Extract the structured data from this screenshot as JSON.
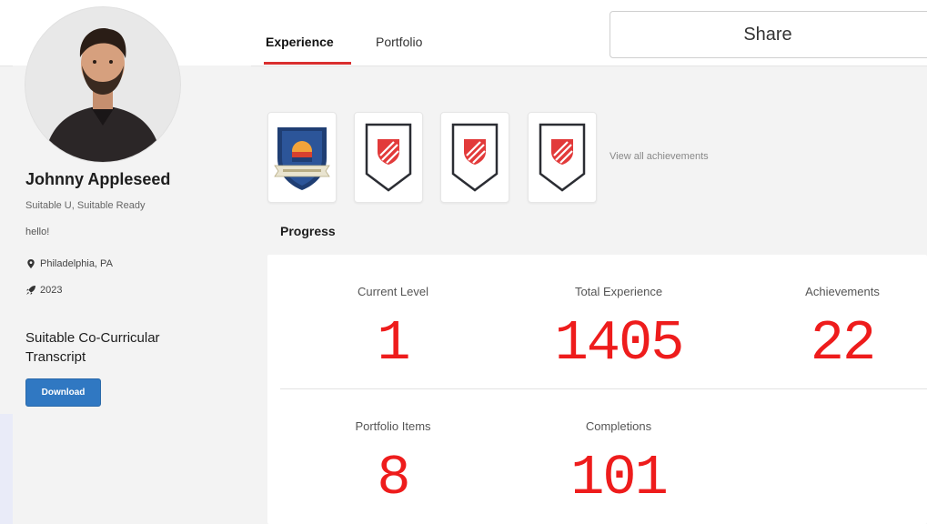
{
  "profile": {
    "name": "Johnny Appleseed",
    "subtitle": "Suitable U, Suitable Ready",
    "bio": "hello!",
    "location": "Philadelphia, PA",
    "year": "2023",
    "transcript_title": "Suitable Co-Curricular Transcript",
    "download_label": "Download"
  },
  "tabs": [
    {
      "label": "Experience",
      "active": true
    },
    {
      "label": "Portfolio",
      "active": false
    }
  ],
  "share_label": "Share",
  "achievements": {
    "badges": [
      {
        "icon": "university-crest-icon"
      },
      {
        "icon": "shield-badge-icon"
      },
      {
        "icon": "shield-badge-icon"
      },
      {
        "icon": "shield-badge-icon"
      }
    ],
    "view_all_label": "View all achievements"
  },
  "progress": {
    "title": "Progress",
    "stats": [
      {
        "label": "Current Level",
        "value": "1"
      },
      {
        "label": "Total Experience",
        "value": "1405"
      },
      {
        "label": "Achievements",
        "value": "22"
      },
      {
        "label": "Portfolio Items",
        "value": "8"
      },
      {
        "label": "Completions",
        "value": "101"
      }
    ]
  },
  "colors": {
    "accent_red": "#ee1c1c",
    "tab_underline": "#d92f2f",
    "button_blue": "#3078c2",
    "badge_shield": "#e23a3a"
  }
}
